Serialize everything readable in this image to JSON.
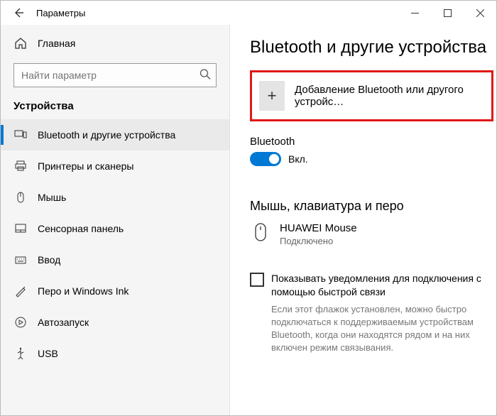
{
  "window": {
    "title": "Параметры"
  },
  "sidebar": {
    "home": "Главная",
    "search_placeholder": "Найти параметр",
    "category": "Устройства",
    "items": [
      {
        "label": "Bluetooth и другие устройства"
      },
      {
        "label": "Принтеры и сканеры"
      },
      {
        "label": "Мышь"
      },
      {
        "label": "Сенсорная панель"
      },
      {
        "label": "Ввод"
      },
      {
        "label": "Перо и Windows Ink"
      },
      {
        "label": "Автозапуск"
      },
      {
        "label": "USB"
      }
    ]
  },
  "main": {
    "title": "Bluetooth и другие устройства",
    "add_label": "Добавление Bluetooth или другого устройс…",
    "bt_heading": "Bluetooth",
    "bt_toggle_label": "Вкл.",
    "devices_heading": "Мышь, клавиатура и перо",
    "device": {
      "name": "HUAWEI  Mouse",
      "status": "Подключено"
    },
    "checkbox_label": "Показывать уведомления для подключения с помощью быстрой связи",
    "helper_text": "Если этот флажок установлен, можно быстро подключаться к поддерживаемым устройствам Bluetooth, когда они находятся рядом и на них включен режим связывания."
  }
}
